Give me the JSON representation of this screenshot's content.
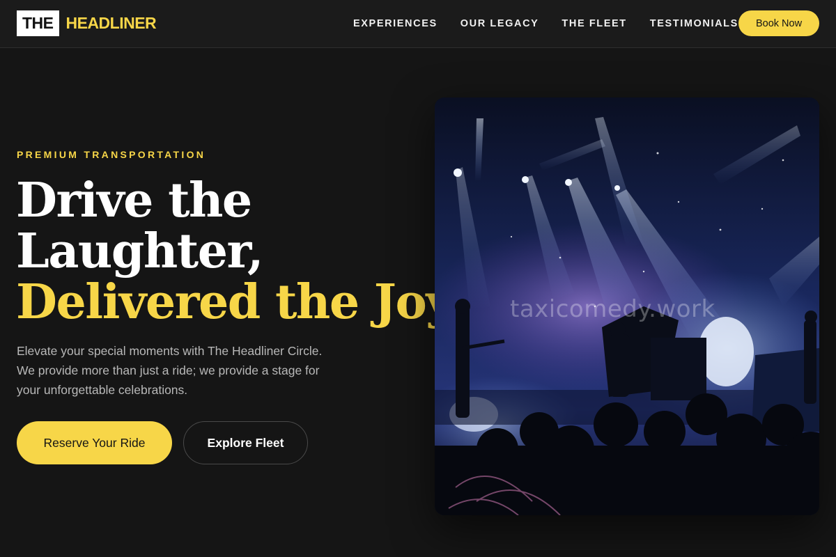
{
  "brand": {
    "logo_box_text": "THE",
    "logo_word": "HEADLINER"
  },
  "nav": {
    "items": [
      "EXPERIENCES",
      "OUR LEGACY",
      "THE FLEET",
      "TESTIMONIALS"
    ],
    "book_label": "Book Now"
  },
  "hero": {
    "eyebrow": "PREMIUM TRANSPORTATION",
    "headline_line1": "Drive the",
    "headline_line2": "Laughter,",
    "headline_line3": "Delivered the Joy.",
    "subtext": "Elevate your special moments with The Headliner Circle. We provide more than just a ride; we provide a stage for your unforgettable celebrations.",
    "primary_cta": "Reserve Your Ride",
    "secondary_cta": "Explore Fleet",
    "image_watermark": "taxicomedy.work"
  },
  "colors": {
    "accent": "#f7d648",
    "background": "#151515",
    "header": "#1b1b1b"
  }
}
